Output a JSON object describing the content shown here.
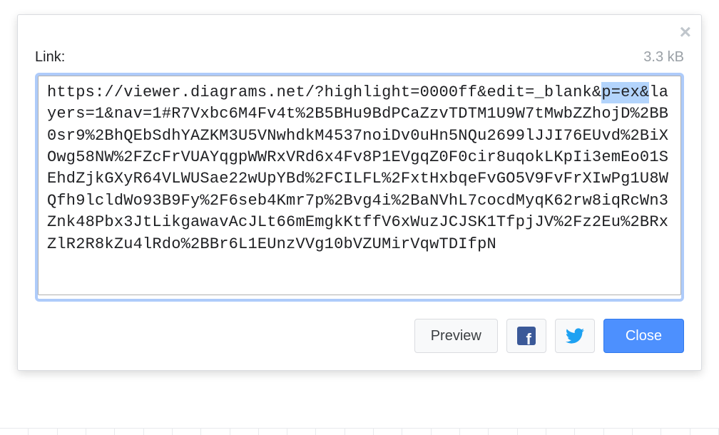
{
  "dialog": {
    "close_glyph": "×",
    "link_label": "Link:",
    "size_label": "3.3 kB",
    "textarea_value": "https://viewer.diagrams.net/?highlight=0000ff&edit=_blank&p=ex&layers=1&nav=1#R7Vxbc6M4Fv4t%2B5BHu9BdPCaZzvTDTM1U9W7tMwbZZhojD%2BB0sr9%2BhQEbSdhYAZKM3U5VNwhdkM4537noiDv0uHn5NQu2699lJJI76EUvd%2BiXOwg58NW%2FZcFrVUAYqgpWWRxVRd6x4Fv8P1EVgqZ0F0cir8uqokLKpIi3emEo01SEhdZjkGXyR64VLWUSae22wUpYBd%2FCILFL%2FxtHxbqeFvGO5V9FvFrXIwPg1U8WQfh9lcldWo93B9Fy%2F6seb4Kmr7p%2Bvg4i%2BaNVhL7cocdMyqK62rw8iqRcWn3Znk48Pbx3JtLikgawavAcJLt66mEmgkKtffV6xWuzJCJSK1TfpjJV%2Fz2Eu%2BRxZlR2R8kZu4lRdo%2BBr6L1EUnzVVg10bVZUMirVqwTDIfpN",
    "buttons": {
      "preview": "Preview",
      "close": "Close"
    },
    "icons": {
      "facebook": "facebook-icon",
      "twitter": "twitter-icon",
      "close_x": "close-icon"
    }
  }
}
